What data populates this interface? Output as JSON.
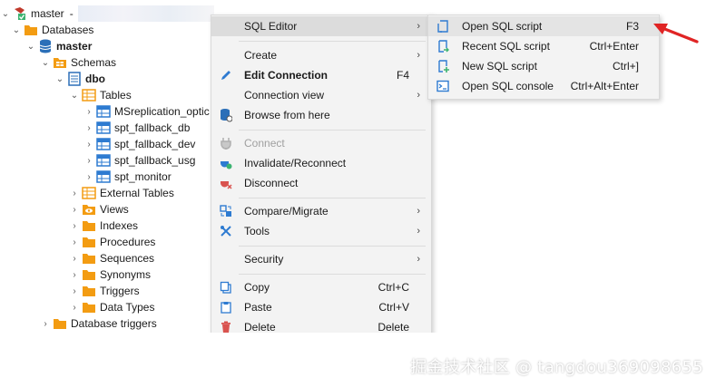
{
  "tree": {
    "root": {
      "label": "master",
      "suffix": "-"
    },
    "items": [
      {
        "label": "Databases"
      },
      {
        "label": "master"
      },
      {
        "label": "Schemas"
      },
      {
        "label": "dbo"
      },
      {
        "label": "Tables"
      },
      {
        "label": "MSreplication_optic"
      },
      {
        "label": "spt_fallback_db"
      },
      {
        "label": "spt_fallback_dev"
      },
      {
        "label": "spt_fallback_usg"
      },
      {
        "label": "spt_monitor"
      },
      {
        "label": "External Tables"
      },
      {
        "label": "Views"
      },
      {
        "label": "Indexes"
      },
      {
        "label": "Procedures"
      },
      {
        "label": "Sequences"
      },
      {
        "label": "Synonyms"
      },
      {
        "label": "Triggers"
      },
      {
        "label": "Data Types"
      },
      {
        "label": "Database triggers"
      }
    ]
  },
  "context_menu": {
    "items": [
      {
        "label": "SQL Editor",
        "shortcut": ""
      },
      {
        "label": "Create",
        "shortcut": ""
      },
      {
        "label": "Edit Connection",
        "shortcut": "F4"
      },
      {
        "label": "Connection view",
        "shortcut": ""
      },
      {
        "label": "Browse from here",
        "shortcut": ""
      },
      {
        "label": "Connect",
        "shortcut": ""
      },
      {
        "label": "Invalidate/Reconnect",
        "shortcut": ""
      },
      {
        "label": "Disconnect",
        "shortcut": ""
      },
      {
        "label": "Compare/Migrate",
        "shortcut": ""
      },
      {
        "label": "Tools",
        "shortcut": ""
      },
      {
        "label": "Security",
        "shortcut": ""
      },
      {
        "label": "Copy",
        "shortcut": "Ctrl+C"
      },
      {
        "label": "Paste",
        "shortcut": "Ctrl+V"
      },
      {
        "label": "Delete",
        "shortcut": "Delete"
      }
    ]
  },
  "submenu": {
    "items": [
      {
        "label": "Open SQL script",
        "shortcut": "F3"
      },
      {
        "label": "Recent SQL script",
        "shortcut": "Ctrl+Enter"
      },
      {
        "label": "New SQL script",
        "shortcut": "Ctrl+]"
      },
      {
        "label": "Open SQL console",
        "shortcut": "Ctrl+Alt+Enter"
      }
    ]
  },
  "watermark": "掘金技术社区 @ tangdou369098655",
  "colors": {
    "folder": "#f39c12",
    "table": "#2e7bd1",
    "db": "#2b6fb8",
    "arrow": "#e02424",
    "menu_bg": "#f3f3f3"
  }
}
